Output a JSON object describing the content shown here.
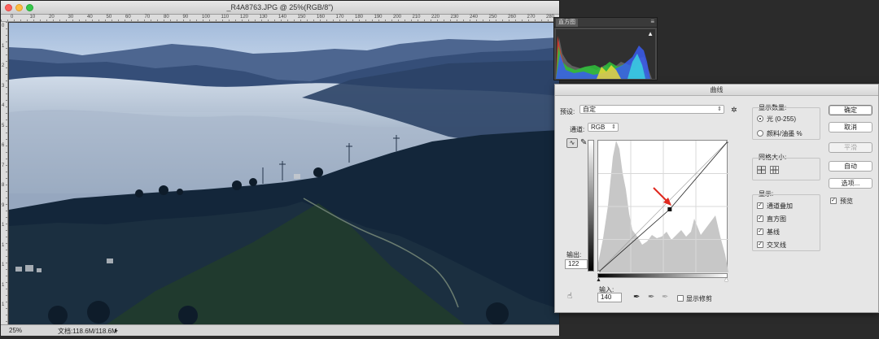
{
  "document": {
    "title": "_R4A8763.JPG @ 25%(RGB/8\")",
    "zoom": "25%",
    "doc_size": "文档:118.6M/118.6M",
    "ruler_top": [
      "0",
      "10",
      "20",
      "30",
      "40",
      "50",
      "60",
      "70",
      "80",
      "90",
      "100",
      "110",
      "120",
      "130",
      "140",
      "150",
      "160",
      "170",
      "180",
      "190",
      "200",
      "210",
      "220",
      "230",
      "240",
      "250",
      "260",
      "270",
      "280"
    ],
    "ruler_left": [
      "0",
      "1",
      "2",
      "3",
      "4",
      "5",
      "6",
      "7",
      "8",
      "9",
      "1",
      "1",
      "1",
      "1",
      "1"
    ]
  },
  "histogram_panel": {
    "tab_label": "直方图",
    "warning_icon": "warning-triangle-icon",
    "colors": {
      "red": "#e23a2e",
      "green": "#2ec23a",
      "blue": "#3a5cf0",
      "yellow": "#e8d83a",
      "cyan": "#3ad8e0",
      "gray": "#b8b8b8"
    }
  },
  "curves": {
    "title": "曲线",
    "preset_label": "预设:",
    "preset_value": "自定",
    "channel_label": "通道:",
    "channel_value": "RGB",
    "output_label": "输出:",
    "output_value": "122",
    "input_label": "输入:",
    "input_value": "140",
    "show_clipping": "显示修剪",
    "point": {
      "input": 140,
      "output": 122
    },
    "display_amount": {
      "title": "显示数量:",
      "light": "光 (0-255)",
      "pigment": "颜料/油墨 %",
      "selected": "light"
    },
    "grid_size": {
      "title": "网格大小:"
    },
    "show": {
      "title": "显示:",
      "options": [
        {
          "label": "通道叠加",
          "checked": true
        },
        {
          "label": "直方图",
          "checked": true
        },
        {
          "label": "基线",
          "checked": true
        },
        {
          "label": "交叉线",
          "checked": true
        }
      ]
    },
    "buttons": {
      "ok": "确定",
      "cancel": "取消",
      "smooth": "平滑",
      "auto": "自动",
      "options": "选项..."
    },
    "preview_label": "预览",
    "preview_checked": true
  }
}
